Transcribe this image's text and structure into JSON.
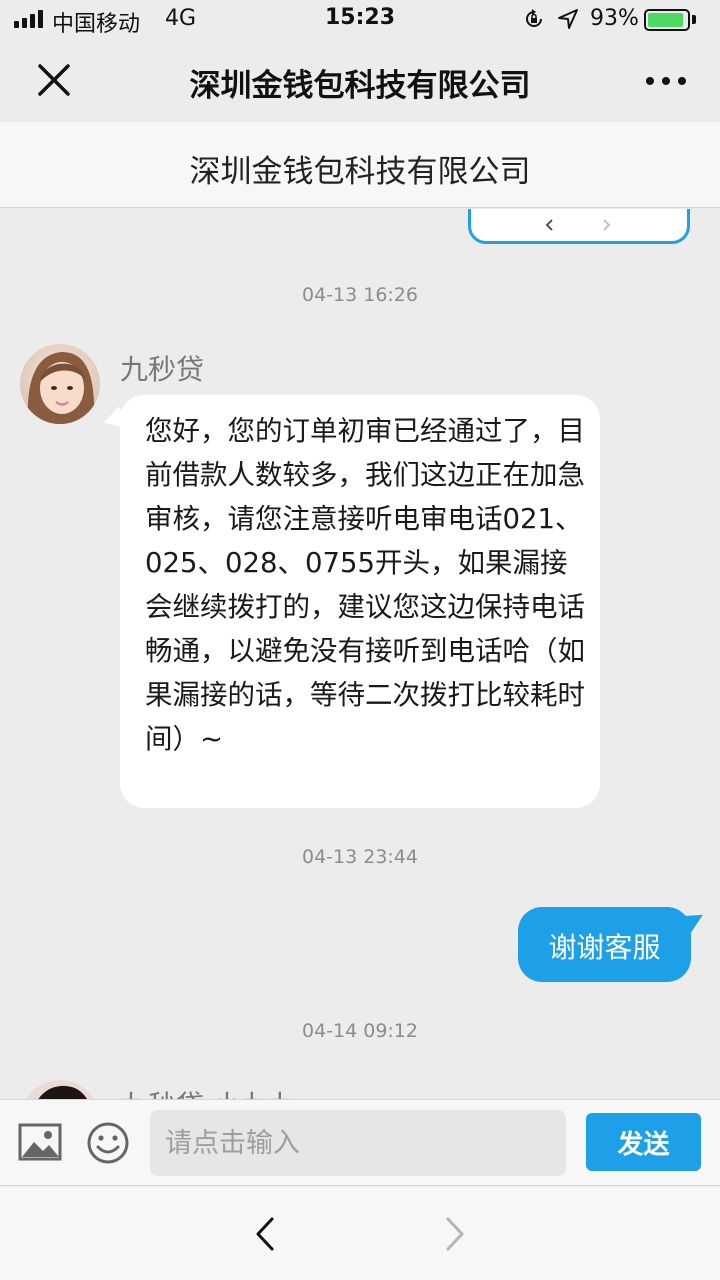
{
  "status_bar": {
    "carrier": "中国移动",
    "network": "4G",
    "time": "15:23",
    "battery_percent": "93%",
    "battery_level": 0.93,
    "icons": [
      "signal-icon",
      "rotation-lock-icon",
      "location-icon",
      "battery-icon"
    ]
  },
  "nav": {
    "title": "深圳金钱包科技有限公司",
    "close_icon": "close-icon",
    "more_icon": "more-icon"
  },
  "sub_header": {
    "title": "深圳金钱包科技有限公司"
  },
  "chat": {
    "messages": [
      {
        "timestamp": "04-13 16:26",
        "sender": "九秒贷",
        "side": "left",
        "text": "您好，您的订单初审已经通过了，目前借款人数较多，我们这边正在加急审核，请您注意接听电审电话021、025、028、0755开头，如果漏接会继续拨打的，建议您这边保持电话畅通，以避免没有接听到电话哈（如果漏接的话，等待二次拨打比较耗时间）~"
      },
      {
        "timestamp": "04-13 23:44",
        "side": "right",
        "text": "谢谢客服"
      },
      {
        "timestamp": "04-14 09:12",
        "sender": "九秒贷 小九九",
        "side": "left",
        "text": ""
      }
    ]
  },
  "input_bar": {
    "placeholder": "请点击输入",
    "send_label": "发送",
    "icons": [
      "image-icon",
      "emoji-icon"
    ]
  },
  "bottom_nav": {
    "icons": [
      "back-arrow-icon",
      "forward-arrow-icon"
    ]
  },
  "colors": {
    "accent": "#1ea0e8",
    "background": "#ececec",
    "battery": "#4cd964"
  }
}
